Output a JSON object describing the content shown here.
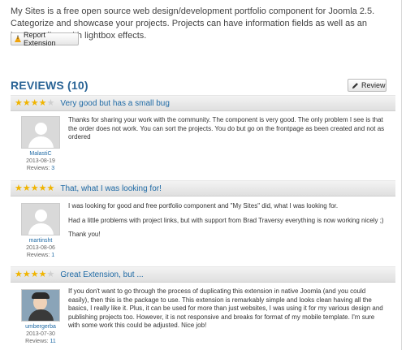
{
  "intro": "My Sites is a free open source web design/development portfolio component for Joomla 2.5. Categorize and showcase your projects. Projects can have information fields as well as an image gallery with lightbox effects.",
  "report_label": "Report Extension",
  "reviews_title": "REVIEWS (10)",
  "review_button_label": "Review",
  "colors": {
    "accent": "#1f6aa5",
    "star": "#f0b400",
    "heading": "#2a6496"
  },
  "reviews": [
    {
      "rating": 4,
      "title": "Very good but has a small bug",
      "user": "MalastiC",
      "date": "2013-08-19",
      "reviews_label": "Reviews:",
      "reviews_count": "3",
      "paragraphs": [
        "Thanks for sharing your work with the community. The component is very good. The only problem I see is that the order does not work. You can sort the projects. You do but go on the frontpage as been created and not as ordered"
      ]
    },
    {
      "rating": 5,
      "title": "That, what I was looking for!",
      "user": "martinsht",
      "date": "2013-08-06",
      "reviews_label": "Reviews:",
      "reviews_count": "1",
      "paragraphs": [
        "I was looking for good and free portfolio component and \"My Sites\" did, what I was looking for.",
        "Had a little problems with project links, but with support from Brad Traversy everything is now working nicely ;)",
        "Thank you!"
      ]
    },
    {
      "rating": 4,
      "title": "Great Extension, but ...",
      "user": "umbergerba",
      "date": "2013-07-30",
      "reviews_label": "Reviews:",
      "reviews_count": "11",
      "paragraphs": [
        "If you don't want to go through the process of duplicating this extension in native Joomla (and you could easily), then this is the package to use. This extension is remarkably simple and looks clean having all the basics, I really like it. Plus, it can be used for more than just websites, I was using it for my various design and publishing projects too. However, it is not responsive and breaks for format of my mobile template. I'm sure with some work this could be adjusted. Nice job!"
      ]
    }
  ]
}
